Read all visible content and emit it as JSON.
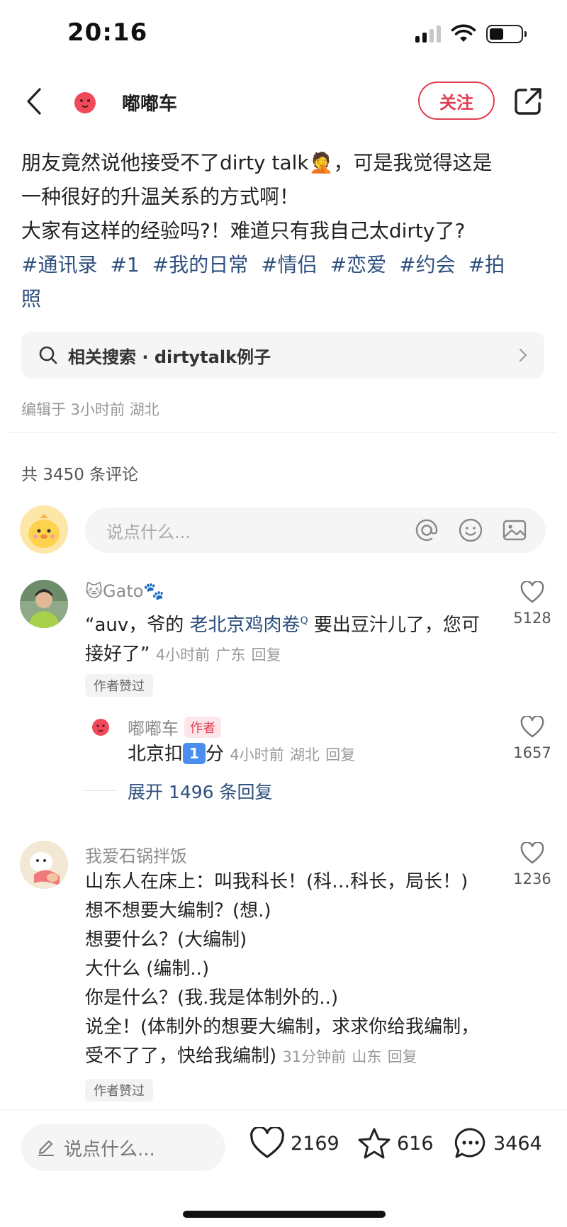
{
  "status": {
    "time": "20:16"
  },
  "header": {
    "author": "嘟嘟车",
    "follow_label": "关注"
  },
  "post": {
    "line1": "朋友竟然说他接受不了dirty talk🤦，可是我觉得这是",
    "line2": "一种很好的升温关系的方式啊！",
    "line3": "大家有这样的经验吗?！难道只有我自己太dirty了?",
    "hashtags": [
      "#通讯录",
      "#1",
      "#我的日常",
      "#情侣",
      "#恋爱",
      "#约会",
      "#拍"
    ],
    "hashtag_wrap": "照"
  },
  "related_search": "相关搜索 · dirtytalk例子",
  "edit_meta": "编辑于 3小时前 湖北",
  "comment_count": "共 3450 条评论",
  "comment_input": {
    "placeholder": "说点什么..."
  },
  "comments": [
    {
      "name": "🐱Gato🐾",
      "text_part1": "“auv，爷的 ",
      "link": "老北京鸡肉卷",
      "text_part2": " 要出豆汁儿了，您可",
      "text_line2": "接好了”",
      "time": "4小时前",
      "location": "广东",
      "reply": "回复",
      "likes": "5128",
      "chip": "作者赞过"
    },
    {
      "name": "我爱石锅拌饭",
      "lines": [
        "山东人在床上：叫我科长！(科…科长，局长！)",
        "想不想要大编制？(想.)",
        "想要什么？(大编制)",
        "大什么 (编制..)",
        "你是什么？(我.我是体制外的..)",
        "说全！(体制外的想要大编制，求求你给我编制，",
        "受不了了，快给我编制)"
      ],
      "time": "31分钟前",
      "location": "山东",
      "reply": "回复",
      "likes": "1236",
      "chip": "作者赞过"
    }
  ],
  "reply": {
    "name": "嘟嘟车",
    "author_tag": "作者",
    "text_before": "北京扣",
    "badge": "1",
    "text_after": "分",
    "time": "4小时前",
    "location": "湖北",
    "reply": "回复",
    "likes": "1657",
    "expand": "展开 1496 条回复"
  },
  "bottom": {
    "placeholder": "说点什么...",
    "likes": "2169",
    "stars": "616",
    "comments": "3464"
  },
  "colors": {
    "accent": "#e23d52",
    "link": "#2e4f7e"
  }
}
